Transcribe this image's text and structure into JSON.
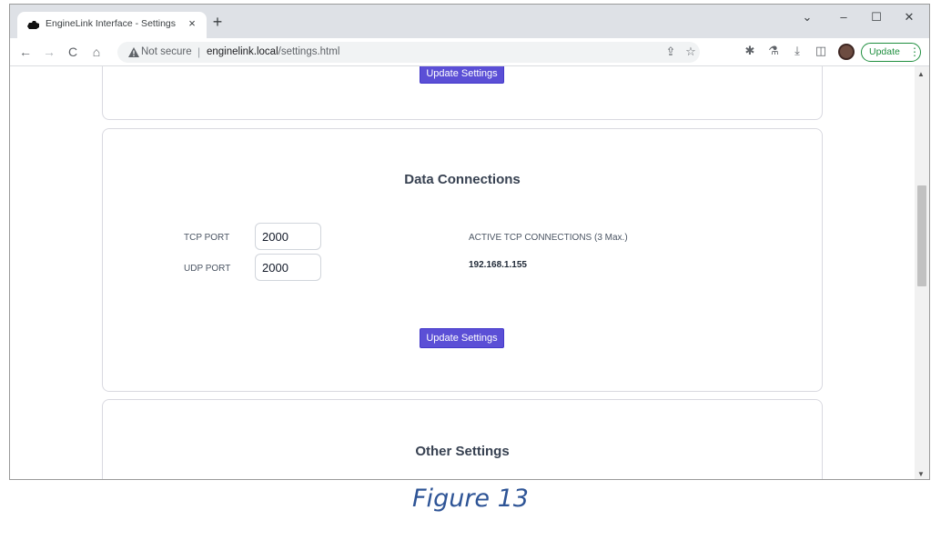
{
  "browser": {
    "tab_title": "EngineLink Interface - Settings",
    "tab_close": "×",
    "new_tab": "+",
    "window_controls": {
      "chevron": "⌄",
      "minimize": "–",
      "maximize": "☐",
      "close": "✕"
    },
    "nav": {
      "back": "←",
      "forward": "→",
      "reload": "C",
      "home": "⌂"
    },
    "security_text": "Not secure",
    "separator": "|",
    "url_host": "enginelink.local",
    "url_path": "/settings.html",
    "update_label": "Update",
    "update_menu": "⋮",
    "icons": [
      "share-icon",
      "star-icon",
      "extensions-icon",
      "labs-icon",
      "download-icon",
      "sidepanel-icon",
      "profile-avatar"
    ]
  },
  "page": {
    "top_card": {
      "button_label": "Update Settings"
    },
    "data_connections": {
      "heading": "Data Connections",
      "tcp_label": "TCP PORT",
      "tcp_value": "2000",
      "udp_label": "UDP PORT",
      "udp_value": "2000",
      "active_title": "ACTIVE TCP CONNECTIONS (3 Max.)",
      "active_connections": [
        "192.168.1.155"
      ],
      "button_label": "Update Settings"
    },
    "other_settings": {
      "heading": "Other Settings"
    }
  },
  "colors": {
    "accent_button": "#5b4fd6",
    "caption": "#2e5496",
    "update_green": "#1e8e3e"
  },
  "caption": "Figure 13"
}
